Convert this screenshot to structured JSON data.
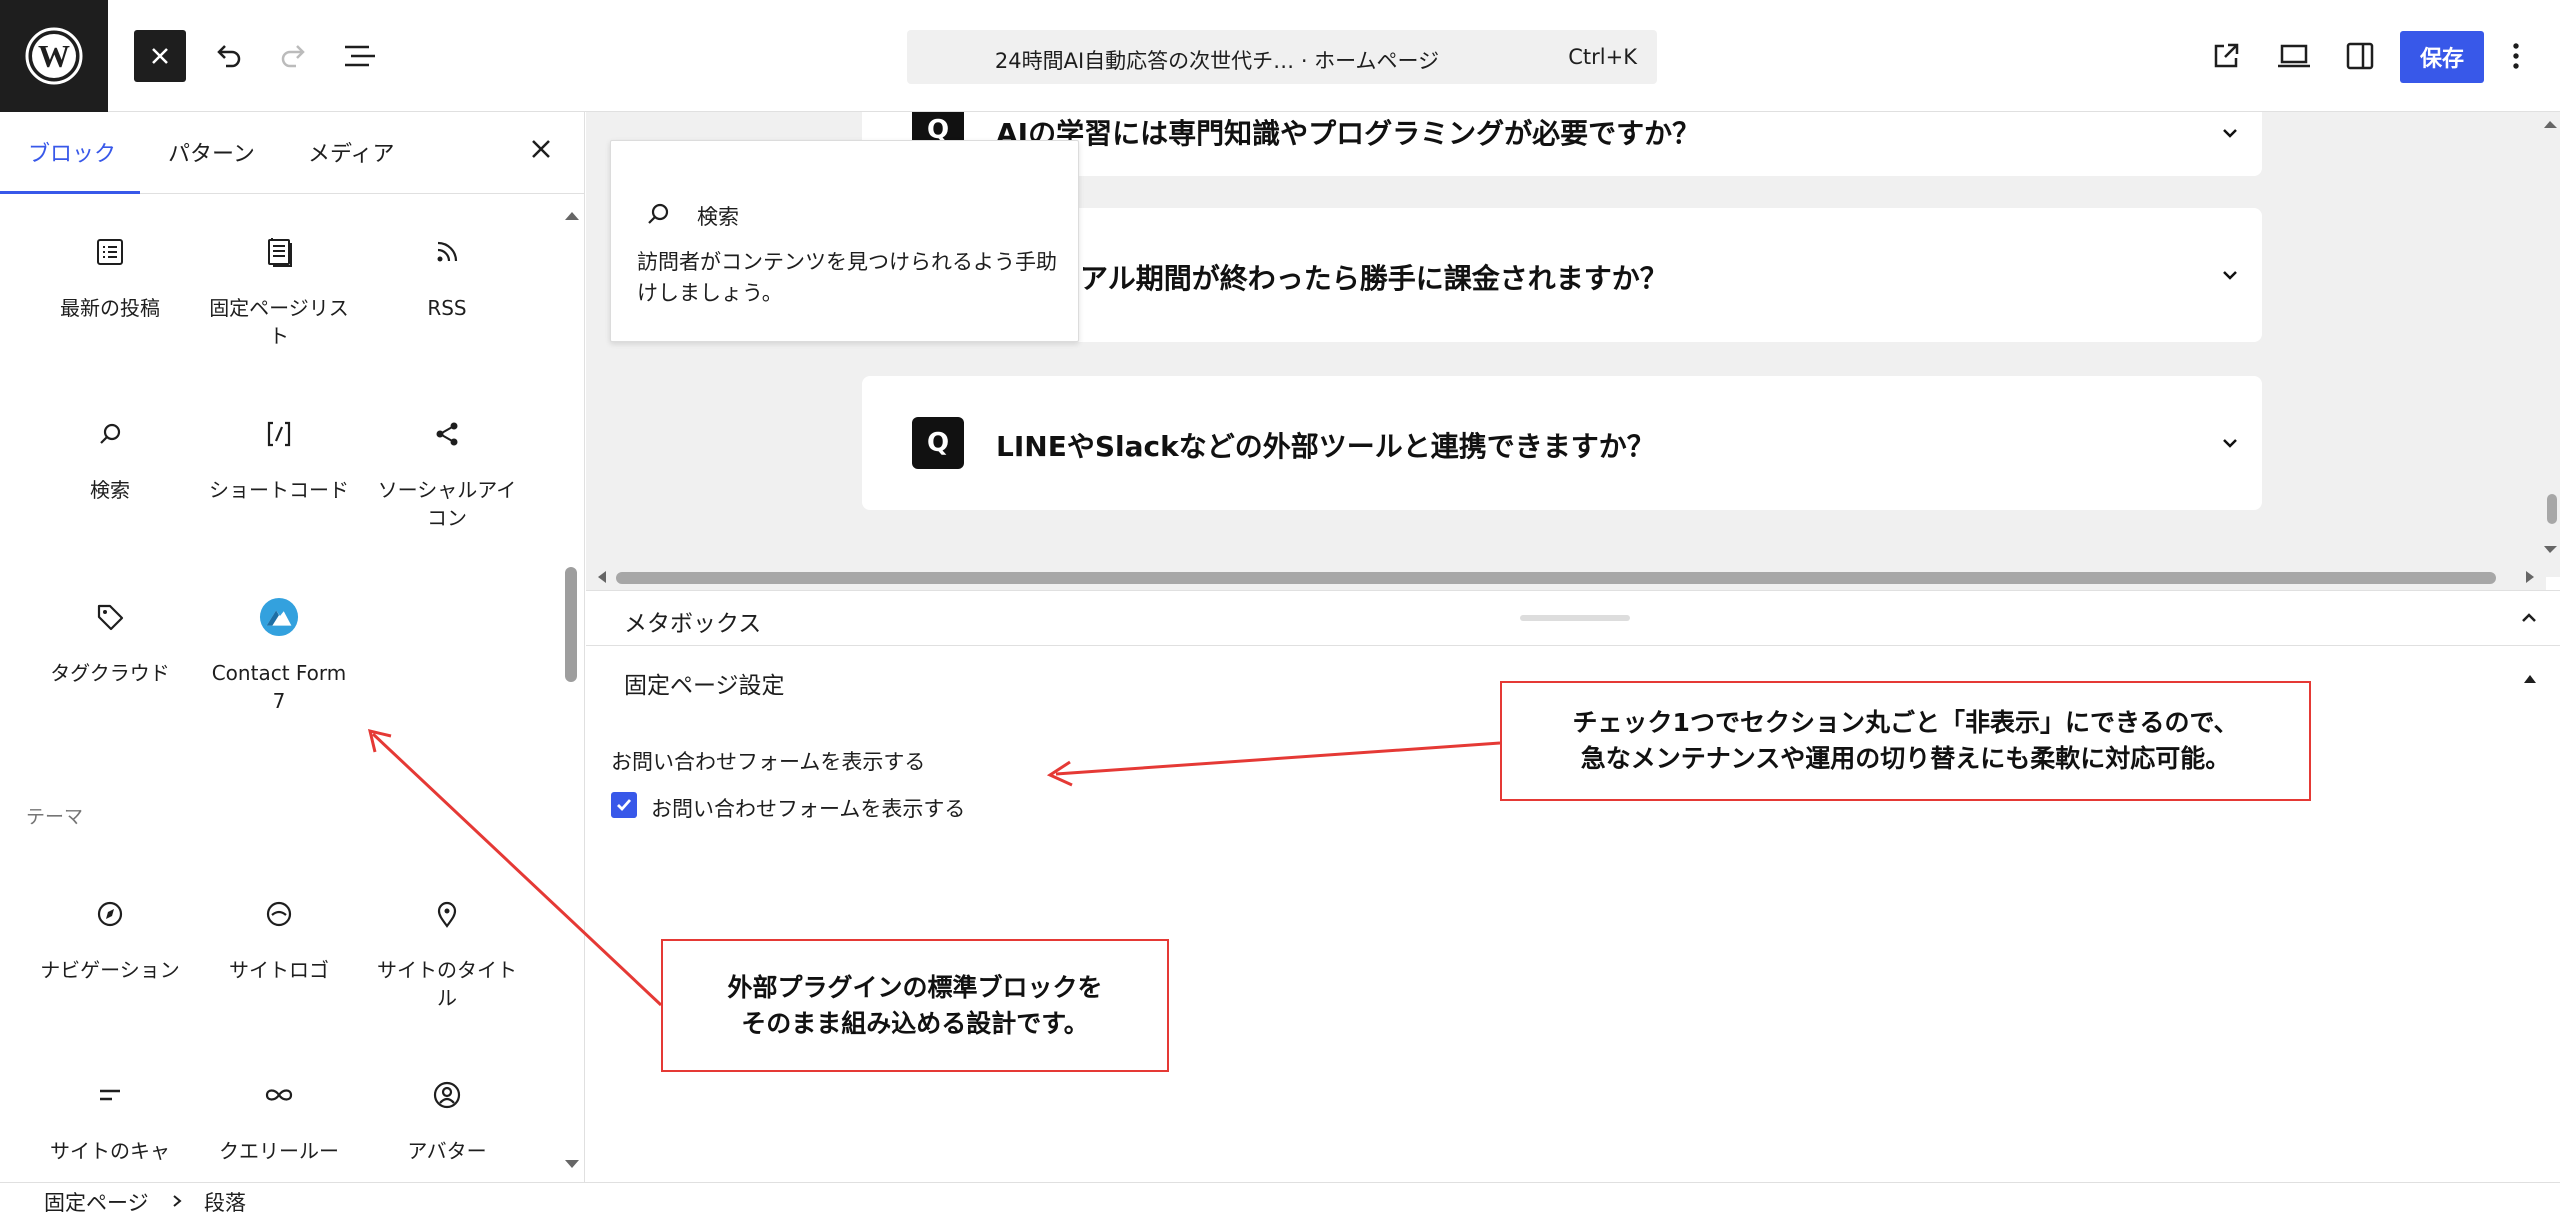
{
  "topbar": {
    "command_title": "24時間AI自動応答の次世代チ… · ホームページ",
    "command_shortcut": "Ctrl+K",
    "save_label": "保存"
  },
  "inserter": {
    "tabs": [
      "ブロック",
      "パターン",
      "メディア"
    ],
    "blocks_top": [
      {
        "label": "最新の投稿",
        "icon": "latest-posts-icon"
      },
      {
        "label": "固定ページリスト",
        "icon": "page-list-icon"
      },
      {
        "label": "RSS",
        "icon": "rss-icon"
      },
      {
        "label": "検索",
        "icon": "search-icon"
      },
      {
        "label": "ショートコード",
        "icon": "shortcode-icon"
      },
      {
        "label": "ソーシャルアイコン",
        "icon": "share-icon"
      },
      {
        "label": "タグクラウド",
        "icon": "tag-icon"
      },
      {
        "label": "Contact Form 7",
        "icon": "contact-form-7-icon"
      }
    ],
    "theme_section": "テーマ",
    "blocks_theme": [
      {
        "label": "ナビゲーション",
        "icon": "navigation-icon"
      },
      {
        "label": "サイトロゴ",
        "icon": "site-logo-icon"
      },
      {
        "label": "サイトのタイトル",
        "icon": "map-pin-icon"
      },
      {
        "label": "サイトのキャ",
        "icon": "tagline-icon"
      },
      {
        "label": "クエリールー",
        "icon": "loop-icon"
      },
      {
        "label": "アバター",
        "icon": "avatar-icon"
      }
    ]
  },
  "popover": {
    "title": "検索",
    "description": "訪問者がコンテンツを見つけられるよう手助けしましょう。"
  },
  "faq": [
    {
      "q": "Q",
      "text": "AIの学習には専門知識やプログラミングが必要ですか？"
    },
    {
      "q": "Q",
      "text": "トライアル期間が終わったら勝手に課金されますか？"
    },
    {
      "q": "Q",
      "text": "LINEやSlackなどの外部ツールと連携できますか？"
    }
  ],
  "metabox": {
    "title": "メタボックス",
    "settings_title": "固定ページ設定",
    "field_label": "お問い合わせフォームを表示する",
    "checkbox_label": "お問い合わせフォームを表示する",
    "checkbox_checked": true
  },
  "annotations": {
    "right": [
      "チェック1つでセクション丸ごと「非表示」にできるので、",
      "急なメンテナンスや運用の切り替えにも柔軟に対応可能。"
    ],
    "bottom": [
      "外部プラグインの標準ブロックを",
      "そのまま組み込める設計です。"
    ]
  },
  "breadcrumb": [
    "固定ページ",
    "段落"
  ],
  "colors": {
    "accent": "#3858e9",
    "annotation": "#e53935",
    "canvas": "#f0f0f0"
  }
}
